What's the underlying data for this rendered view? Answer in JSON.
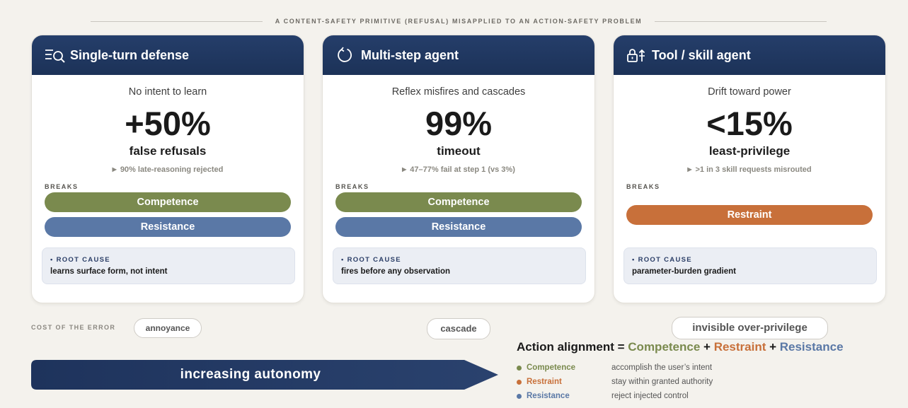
{
  "header": {
    "title": "A CONTENT-SAFETY PRIMITIVE (REFUSAL) MISAPPLIED TO AN ACTION-SAFETY PROBLEM"
  },
  "cards": [
    {
      "title": "Single-turn defense",
      "icon": "search-list-icon",
      "subtitle": "No intent to learn",
      "big_value": "+50%",
      "metric": "false refusals",
      "note": "90% late-reasoning rejected",
      "breaks_label": "BREAKS",
      "breaks": [
        "Competence",
        "Resistance"
      ],
      "root_cause_label": "• ROOT CAUSE",
      "root_cause": "learns surface form, not intent"
    },
    {
      "title": "Multi-step agent",
      "icon": "refresh-icon",
      "subtitle": "Reflex misfires and cascades",
      "big_value": "99%",
      "metric": "timeout",
      "note": "47–77% fail at step 1 (vs 3%)",
      "breaks_label": "BREAKS",
      "breaks": [
        "Competence",
        "Resistance"
      ],
      "root_cause_label": "• ROOT CAUSE",
      "root_cause": "fires before any observation"
    },
    {
      "title": "Tool / skill agent",
      "icon": "lock-arrow-icon",
      "subtitle": "Drift toward power",
      "big_value": "<15%",
      "metric": "least-privilege",
      "note": ">1 in 3 skill requests misrouted",
      "breaks_label": "BREAKS",
      "breaks": [
        "Restraint"
      ],
      "root_cause_label": "• ROOT CAUSE",
      "root_cause": "parameter-burden gradient"
    }
  ],
  "cost": {
    "label": "COST OF THE ERROR",
    "values": [
      "annoyance",
      "cascade",
      "invisible over-privilege"
    ]
  },
  "arrow": {
    "label": "increasing autonomy"
  },
  "alignment": {
    "prefix": "Action alignment = ",
    "terms": [
      "Competence",
      "Restraint",
      "Resistance"
    ],
    "plus": " + ",
    "legend": [
      {
        "name": "Competence",
        "desc": "accomplish the user’s intent"
      },
      {
        "name": "Restraint",
        "desc": "stay within granted authority"
      },
      {
        "name": "Resistance",
        "desc": "reject injected control"
      }
    ]
  },
  "colors": {
    "navy": "#1c3258",
    "competence": "#7a8a4e",
    "restraint": "#c8703a",
    "resistance": "#5a78a6",
    "background": "#f4f2ed"
  }
}
